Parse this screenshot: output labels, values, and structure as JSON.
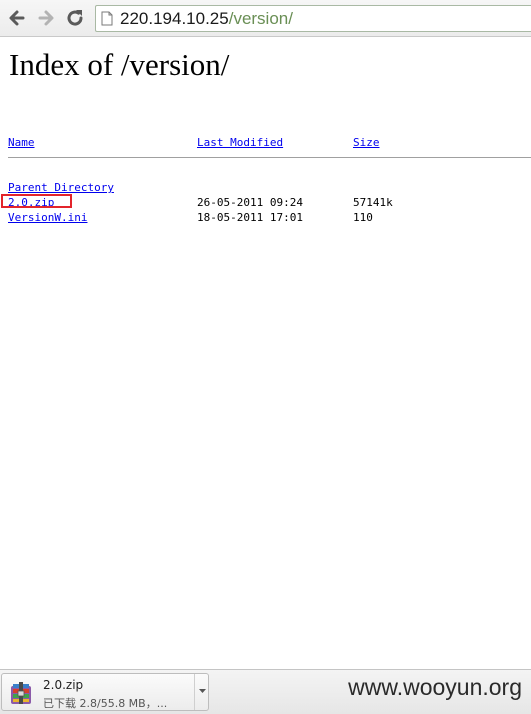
{
  "browser": {
    "url_host": "220.194.10.25",
    "url_path": "/version/",
    "back_icon": "back-arrow-icon",
    "forward_icon": "forward-arrow-icon",
    "reload_icon": "reload-icon",
    "page_icon": "page-icon"
  },
  "page": {
    "title": "Index of /version/",
    "columns": {
      "name": "Name",
      "last_modified": "Last Modified",
      "size": "Size"
    },
    "parent": "Parent Directory",
    "files": [
      {
        "name": "2.0.zip",
        "modified": "26-05-2011 09:24",
        "size": "57141k"
      },
      {
        "name": "VersionW.ini",
        "modified": "18-05-2011 17:01",
        "size": "110"
      }
    ],
    "highlight_color": "#e3242b",
    "link_color": "#0000ee"
  },
  "download_bar": {
    "file_name": "2.0.zip",
    "status": "已下载 2.8/55.8 MB，...",
    "icon": "winrar-archive-icon",
    "menu_icon": "chevron-down-icon"
  },
  "watermark": "www.wooyun.org"
}
